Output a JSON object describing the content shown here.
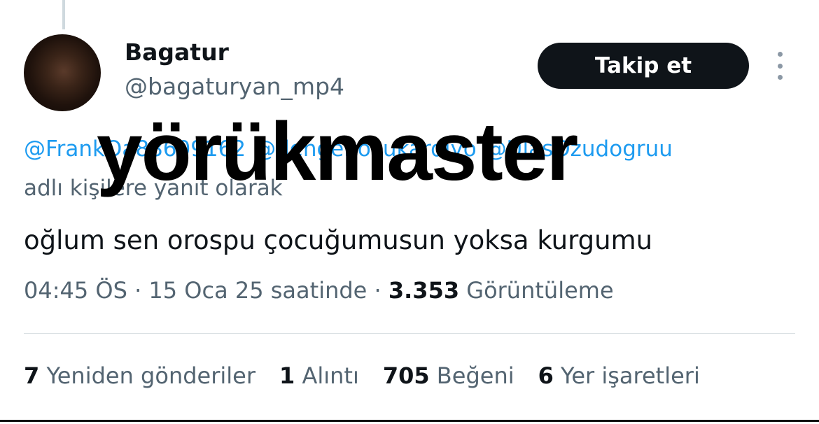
{
  "author": {
    "display_name": "Bagatur",
    "handle": "@bagaturyan_mp4",
    "follow_label": "Takip et"
  },
  "reply": {
    "mentions": [
      "@FrankOa88609162",
      "@dengenocukardiyo",
      "@UlasOzudogruu"
    ],
    "suffix": "adlı kişilere yanıt olarak"
  },
  "overlay_text": "yörükmaster",
  "tweet": {
    "text": "oğlum sen orospu çocuğumusun yoksa kurgumu"
  },
  "meta": {
    "time": "04:45 ÖS",
    "sep1": "·",
    "date": "15 Oca 25 saatinde",
    "sep2": "·",
    "views_count": "3.353",
    "views_label": "Görüntüleme"
  },
  "stats": {
    "retweets_count": "7",
    "retweets_label": "Yeniden gönderiler",
    "quotes_count": "1",
    "quotes_label": "Alıntı",
    "likes_count": "705",
    "likes_label": "Beğeni",
    "bookmarks_count": "6",
    "bookmarks_label": "Yer işaretleri"
  },
  "icons": {
    "more": "more-vertical-icon"
  }
}
